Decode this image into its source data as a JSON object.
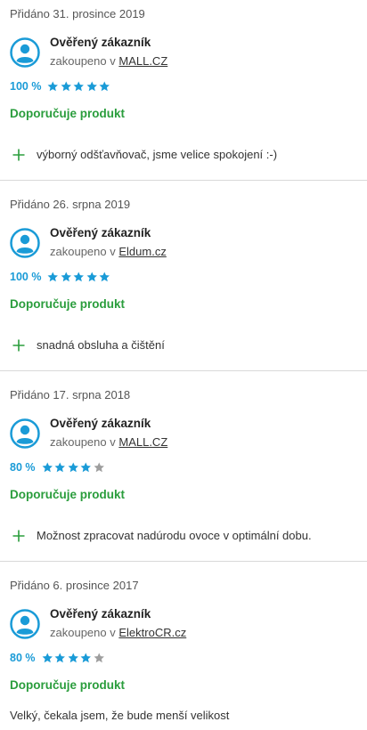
{
  "colors": {
    "accent_blue": "#1a9bd7",
    "recommend_green": "#2a9d3c",
    "star_filled": "#1a9bd7",
    "star_empty": "#9e9e9e",
    "divider": "#d9d9d9"
  },
  "reviews": [
    {
      "date": "Přidáno 31. prosince 2019",
      "author": "Ověřený zákazník",
      "source_prefix": "zakoupeno v",
      "source_link": "MALL.CZ",
      "rating_percent": "100 %",
      "stars_filled": 5,
      "recommend": "Doporučuje produkt",
      "pros": [
        "výborný odšťavňovač, jsme velice spokojení :-)"
      ]
    },
    {
      "date": "Přidáno 26. srpna 2019",
      "author": "Ověřený zákazník",
      "source_prefix": "zakoupeno v",
      "source_link": "Eldum.cz",
      "rating_percent": "100 %",
      "stars_filled": 5,
      "recommend": "Doporučuje produkt",
      "pros": [
        "snadná obsluha a čištění"
      ]
    },
    {
      "date": "Přidáno 17. srpna 2018",
      "author": "Ověřený zákazník",
      "source_prefix": "zakoupeno v",
      "source_link": "MALL.CZ",
      "rating_percent": "80 %",
      "stars_filled": 4,
      "recommend": "Doporučuje produkt",
      "pros": [
        "Možnost zpracovat nadúrodu ovoce v optimální dobu."
      ]
    },
    {
      "date": "Přidáno 6. prosince 2017",
      "author": "Ověřený zákazník",
      "source_prefix": "zakoupeno v",
      "source_link": "ElektroCR.cz",
      "rating_percent": "80 %",
      "stars_filled": 4,
      "recommend": "Doporučuje produkt",
      "comment": "Velký, čekala jsem, že bude menší velikost"
    }
  ]
}
